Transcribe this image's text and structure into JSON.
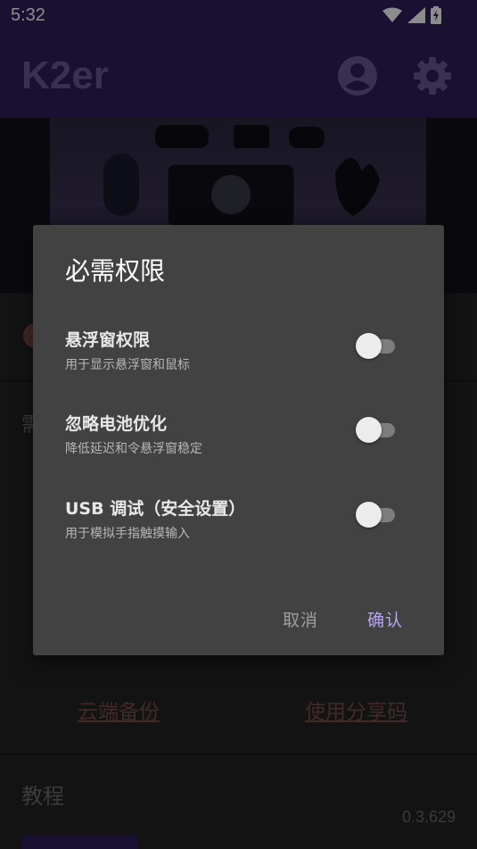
{
  "status_bar": {
    "time": "5:32",
    "icons": [
      "wifi-icon",
      "signal-icon",
      "battery-charging-icon"
    ]
  },
  "app_bar": {
    "title": "K2er",
    "actions": [
      "account-icon",
      "settings-icon"
    ],
    "color": "#2f1e5c"
  },
  "banner": {
    "icon": "gaming-peripherals-image"
  },
  "background": {
    "row_partial_text": "需",
    "links": {
      "cloud_backup": "云端备份",
      "share_code": "使用分享码"
    },
    "tutorial_title": "教程",
    "version": "0.3.629"
  },
  "dialog": {
    "title": "必需权限",
    "permissions": [
      {
        "title": "悬浮窗权限",
        "description": "用于显示悬浮窗和鼠标",
        "enabled": false
      },
      {
        "title": "忽略电池优化",
        "description": "降低延迟和令悬浮窗稳定",
        "enabled": false
      },
      {
        "title": "USB 调试（安全设置）",
        "description": "用于模拟手指触摸输入",
        "enabled": false
      }
    ],
    "cancel_label": "取消",
    "confirm_label": "确认",
    "accent_color": "#b7a5f2"
  }
}
